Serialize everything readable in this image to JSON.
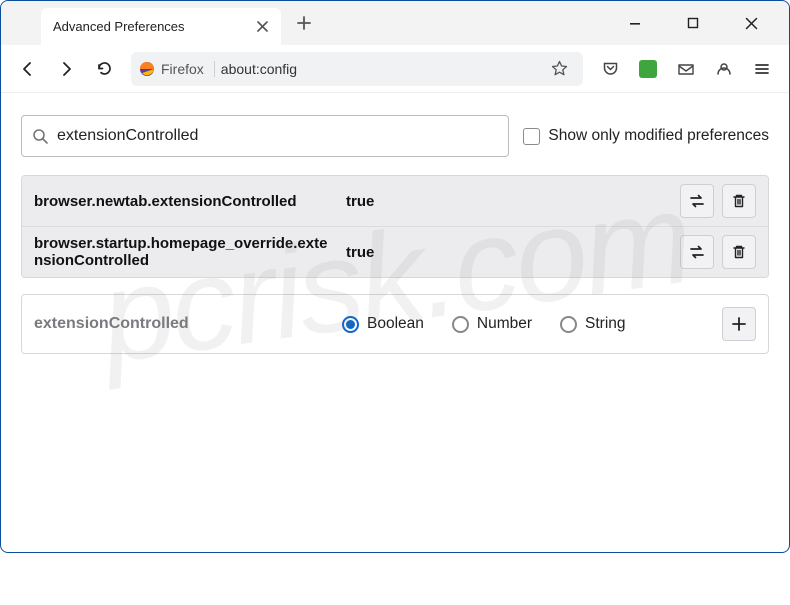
{
  "window": {
    "title": "Advanced Preferences"
  },
  "toolbar": {
    "identity_label": "Firefox",
    "url": "about:config"
  },
  "search": {
    "value": "extensionControlled",
    "show_modified_label": "Show only modified preferences"
  },
  "results": [
    {
      "name": "browser.newtab.extensionControlled",
      "value": "true"
    },
    {
      "name": "browser.startup.homepage_override.extensionControlled",
      "value": "true"
    }
  ],
  "new_pref": {
    "name": "extensionControlled",
    "type_options": {
      "boolean": "Boolean",
      "number": "Number",
      "string": "String"
    },
    "selected": "boolean"
  }
}
